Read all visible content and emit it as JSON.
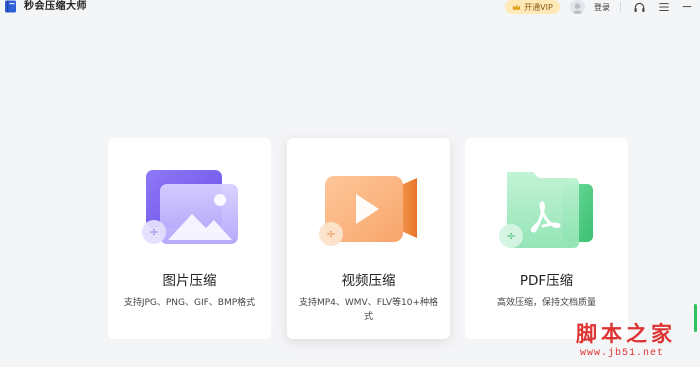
{
  "app": {
    "title": "秒会压缩大师",
    "logo_icon": "book-logo-icon",
    "accent_color": "#3a63d9"
  },
  "header": {
    "vip_label": "开通VIP",
    "login_label": "登录",
    "icons": [
      "headset-icon",
      "menu-icon",
      "minimize-icon"
    ]
  },
  "cards": [
    {
      "title": "图片压缩",
      "desc": "支持JPG、PNG、GIF、BMP格式",
      "icon": "image-compress-icon",
      "colors": [
        "#7b62f0",
        "#b6a8ff"
      ]
    },
    {
      "title": "视频压缩",
      "desc": "支持MP4、WMV、FLV等10+种格式",
      "icon": "video-compress-icon",
      "colors": [
        "#f08a3c",
        "#ffcfa6"
      ]
    },
    {
      "title": "PDF压缩",
      "desc": "高效压缩，保持文档质量",
      "icon": "pdf-compress-icon",
      "colors": [
        "#3dc47a",
        "#a7efc6"
      ]
    }
  ],
  "watermark": {
    "big": "脚本之家",
    "small": "www.jb51.net"
  }
}
